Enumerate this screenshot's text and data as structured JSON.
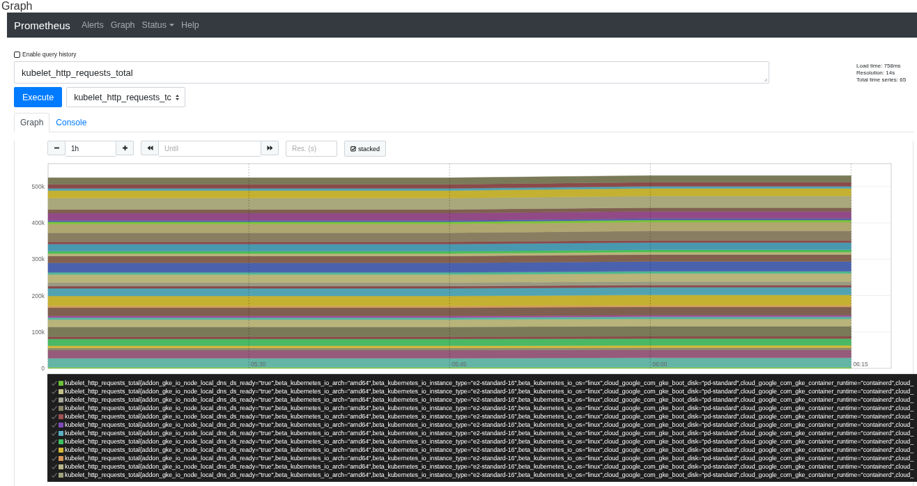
{
  "page_heading": "Graph",
  "navbar": {
    "brand": "Prometheus",
    "links": [
      {
        "label": "Alerts",
        "kind": "link"
      },
      {
        "label": "Graph",
        "kind": "link"
      },
      {
        "label": "Status",
        "kind": "dropdown"
      },
      {
        "label": "Help",
        "kind": "link"
      }
    ]
  },
  "query_history": {
    "label": "Enable query history",
    "checked": false
  },
  "expression": {
    "value": "kubelet_http_requests_total"
  },
  "stats": [
    "Load time: 758ms",
    "Resolution: 14s",
    "Total time series: 65"
  ],
  "execute_button": "Execute",
  "metric_select": {
    "value": "kubelet_http_requests_tc"
  },
  "tabs": [
    {
      "label": "Graph",
      "selected": true
    },
    {
      "label": "Console",
      "selected": false
    }
  ],
  "graph_controls": {
    "range": {
      "value": "1h"
    },
    "until": {
      "placeholder": "Until"
    },
    "resolution": {
      "placeholder": "Res. (s)"
    },
    "stacked": {
      "label": "stacked",
      "checked": true
    }
  },
  "chart_data": {
    "type": "area",
    "stacked": true,
    "grid": true,
    "categories": [
      null,
      "05:30",
      "05:45",
      "06:00",
      "06:15"
    ],
    "ylim": [
      0,
      563000
    ],
    "yticks": [
      {
        "value": 0,
        "label": "0"
      },
      {
        "value": 100000,
        "label": "100k"
      },
      {
        "value": 200000,
        "label": "200k"
      },
      {
        "value": 300000,
        "label": "300k"
      },
      {
        "value": 400000,
        "label": "400k"
      },
      {
        "value": 500000,
        "label": "500k"
      }
    ],
    "series": [
      {
        "color": "#7dc23a",
        "values": [
          3000,
          3000,
          3000,
          3000,
          3000
        ]
      },
      {
        "color": "#64b5a6",
        "values": [
          25000,
          25000,
          25000,
          26000,
          26000
        ]
      },
      {
        "color": "#965a7a",
        "values": [
          22000,
          22000,
          22000,
          22000,
          22000
        ]
      },
      {
        "color": "#8a8a6a",
        "values": [
          6000,
          6000,
          6000,
          6000,
          6000
        ]
      },
      {
        "color": "#d4b83a",
        "values": [
          6000,
          6000,
          6000,
          6000,
          6000
        ]
      },
      {
        "color": "#4bb866",
        "values": [
          19000,
          19000,
          19000,
          19000,
          19000
        ]
      },
      {
        "color": "#8b4a4a",
        "values": [
          6000,
          6000,
          6000,
          6000,
          6000
        ]
      },
      {
        "color": "#7a7a58",
        "values": [
          27000,
          27000,
          27000,
          28000,
          28000
        ]
      },
      {
        "color": "#b8b47a",
        "values": [
          20000,
          20000,
          20000,
          20000,
          20000
        ]
      },
      {
        "color": "#58b5a0",
        "values": [
          6000,
          6000,
          6000,
          6000,
          6000
        ]
      },
      {
        "color": "#a24aa0",
        "values": [
          4000,
          4000,
          4000,
          4000,
          4000
        ]
      },
      {
        "color": "#7f5f4f",
        "values": [
          23000,
          23000,
          23000,
          23000,
          23000
        ]
      },
      {
        "color": "#d49a5a",
        "values": [
          5000,
          5000,
          5000,
          5000,
          5000
        ]
      },
      {
        "color": "#c4b132",
        "values": [
          27000,
          27000,
          27000,
          28000,
          28000
        ]
      },
      {
        "color": "#52a3b2",
        "values": [
          21000,
          21000,
          21000,
          21000,
          21000
        ]
      },
      {
        "color": "#8b4a4a",
        "values": [
          6000,
          6000,
          6000,
          6000,
          6000
        ]
      },
      {
        "color": "#9a9a82",
        "values": [
          10000,
          10000,
          10000,
          10000,
          10000
        ]
      },
      {
        "color": "#b8b47a",
        "values": [
          22000,
          22000,
          22000,
          22000,
          22000
        ]
      },
      {
        "color": "#4fb890",
        "values": [
          6000,
          6000,
          6000,
          6000,
          6000
        ]
      },
      {
        "color": "#4a62ae",
        "values": [
          26000,
          26000,
          26000,
          27000,
          27000
        ]
      },
      {
        "color": "#82624f",
        "values": [
          19000,
          19000,
          19000,
          19000,
          19000
        ]
      },
      {
        "color": "#b8b47a",
        "values": [
          7000,
          7000,
          7000,
          7000,
          7000
        ]
      },
      {
        "color": "#4cbf56",
        "values": [
          6000,
          6000,
          6000,
          6000,
          6000
        ]
      },
      {
        "color": "#4899b0",
        "values": [
          20000,
          20000,
          20000,
          20000,
          20000
        ]
      },
      {
        "color": "#8b4a4a",
        "values": [
          6000,
          6000,
          6000,
          6000,
          6000
        ]
      },
      {
        "color": "#8a7e62",
        "values": [
          25000,
          25000,
          25000,
          26000,
          26000
        ]
      },
      {
        "color": "#b0a670",
        "values": [
          24000,
          24000,
          24000,
          24000,
          24000
        ]
      },
      {
        "color": "#7dc23a",
        "values": [
          6000,
          6000,
          6000,
          6000,
          6000
        ]
      },
      {
        "color": "#4a62ae",
        "values": [
          4000,
          4000,
          4000,
          4000,
          4000
        ]
      },
      {
        "color": "#914a86",
        "values": [
          20000,
          20000,
          20000,
          20000,
          20000
        ]
      },
      {
        "color": "#7f5f4f",
        "values": [
          10000,
          10000,
          10000,
          10000,
          10000
        ]
      },
      {
        "color": "#a8a87c",
        "values": [
          31000,
          31000,
          31000,
          32000,
          32000
        ]
      },
      {
        "color": "#c4b132",
        "values": [
          21000,
          21000,
          21000,
          21000,
          21000
        ]
      },
      {
        "color": "#52a3b2",
        "values": [
          6000,
          6000,
          6000,
          6000,
          6000
        ]
      },
      {
        "color": "#8b4a4a",
        "values": [
          11000,
          11000,
          11000,
          11000,
          11000
        ]
      },
      {
        "color": "#7a7a58",
        "values": [
          18000,
          18000,
          18000,
          18000,
          18000
        ]
      }
    ]
  },
  "legend": [
    {
      "color": "#6ac23a",
      "label": "kubelet_http_requests_total{addon_gke_io_node_local_dns_ds_ready=\"true\",beta_kubernetes_io_arch=\"amd64\",beta_kubernetes_io_instance_type=\"e2-standard-16\",beta_kubernetes_io_os=\"linux\",cloud_google_com_gke_boot_disk=\"pd-standard\",cloud_google_com_gke_container_runtime=\"containerd\",cloud_"
    },
    {
      "color": "#c4c08a",
      "label": "kubelet_http_requests_total{addon_gke_io_node_local_dns_ds_ready=\"true\",beta_kubernetes_io_arch=\"amd64\",beta_kubernetes_io_instance_type=\"e2-standard-16\",beta_kubernetes_io_os=\"linux\",cloud_google_com_gke_boot_disk=\"pd-standard\",cloud_google_com_gke_container_runtime=\"containerd\",cloud_"
    },
    {
      "color": "#a8a89a",
      "label": "kubelet_http_requests_total{addon_gke_io_node_local_dns_ds_ready=\"true\",beta_kubernetes_io_arch=\"amd64\",beta_kubernetes_io_instance_type=\"e2-standard-16\",beta_kubernetes_io_os=\"linux\",cloud_google_com_gke_boot_disk=\"pd-standard\",cloud_google_com_gke_container_runtime=\"containerd\",cloud_"
    },
    {
      "color": "#8a866a",
      "label": "kubelet_http_requests_total{addon_gke_io_node_local_dns_ds_ready=\"true\",beta_kubernetes_io_arch=\"amd64\",beta_kubernetes_io_instance_type=\"e2-standard-16\",beta_kubernetes_io_os=\"linux\",cloud_google_com_gke_boot_disk=\"pd-standard\",cloud_google_com_gke_container_runtime=\"containerd\",cloud_"
    },
    {
      "color": "#a05050",
      "label": "kubelet_http_requests_total{addon_gke_io_node_local_dns_ds_ready=\"true\",beta_kubernetes_io_arch=\"amd64\",beta_kubernetes_io_instance_type=\"e2-standard-16\",beta_kubernetes_io_os=\"linux\",cloud_google_com_gke_boot_disk=\"pd-standard\",cloud_google_com_gke_container_runtime=\"containerd\",cloud_"
    },
    {
      "color": "#7e4ab8",
      "label": "kubelet_http_requests_total{addon_gke_io_node_local_dns_ds_ready=\"true\",beta_kubernetes_io_arch=\"amd64\",beta_kubernetes_io_instance_type=\"e2-standard-16\",beta_kubernetes_io_os=\"linux\",cloud_google_com_gke_boot_disk=\"pd-standard\",cloud_google_com_gke_container_runtime=\"containerd\",cloud_"
    },
    {
      "color": "#5ab0c4",
      "label": "kubelet_http_requests_total{addon_gke_io_node_local_dns_ds_ready=\"true\",beta_kubernetes_io_arch=\"amd64\",beta_kubernetes_io_instance_type=\"e2-standard-16\",beta_kubernetes_io_os=\"linux\",cloud_google_com_gke_boot_disk=\"pd-standard\",cloud_google_com_gke_container_runtime=\"containerd\",cloud_"
    },
    {
      "color": "#40c060",
      "label": "kubelet_http_requests_total{addon_gke_io_node_local_dns_ds_ready=\"true\",beta_kubernetes_io_arch=\"amd64\",beta_kubernetes_io_instance_type=\"e2-standard-16\",beta_kubernetes_io_os=\"linux\",cloud_google_com_gke_boot_disk=\"pd-standard\",cloud_google_com_gke_container_runtime=\"containerd\",cloud_"
    },
    {
      "color": "#d4b83a",
      "label": "kubelet_http_requests_total{addon_gke_io_node_local_dns_ds_ready=\"true\",beta_kubernetes_io_arch=\"amd64\",beta_kubernetes_io_instance_type=\"e2-standard-16\",beta_kubernetes_io_os=\"linux\",cloud_google_com_gke_boot_disk=\"pd-standard\",cloud_google_com_gke_container_runtime=\"containerd\",cloud_"
    },
    {
      "color": "#d8965a",
      "label": "kubelet_http_requests_total{addon_gke_io_node_local_dns_ds_ready=\"true\",beta_kubernetes_io_arch=\"amd64\",beta_kubernetes_io_instance_type=\"e2-standard-16\",beta_kubernetes_io_os=\"linux\",cloud_google_com_gke_boot_disk=\"pd-standard\",cloud_google_com_gke_container_runtime=\"containerd\",cloud_"
    },
    {
      "color": "#b8b88a",
      "label": "kubelet_http_requests_total{addon_gke_io_node_local_dns_ds_ready=\"true\",beta_kubernetes_io_arch=\"amd64\",beta_kubernetes_io_instance_type=\"e2-standard-16\",beta_kubernetes_io_os=\"linux\",cloud_google_com_gke_boot_disk=\"pd-standard\",cloud_google_com_gke_container_runtime=\"containerd\",cloud_"
    },
    {
      "color": "#a0a07a",
      "label": "kubelet_http_requests_total{addon_gke_io_node_local_dns_ds_ready=\"true\",beta_kubernetes_io_arch=\"amd64\",beta_kubernetes_io_instance_type=\"e2-standard-16\",beta_kubernetes_io_os=\"linux\",cloud_google_com_gke_boot_disk=\"pd-standard\",cloud_google_com_gke_container_runtime=\"containerd\",cloud_"
    }
  ]
}
